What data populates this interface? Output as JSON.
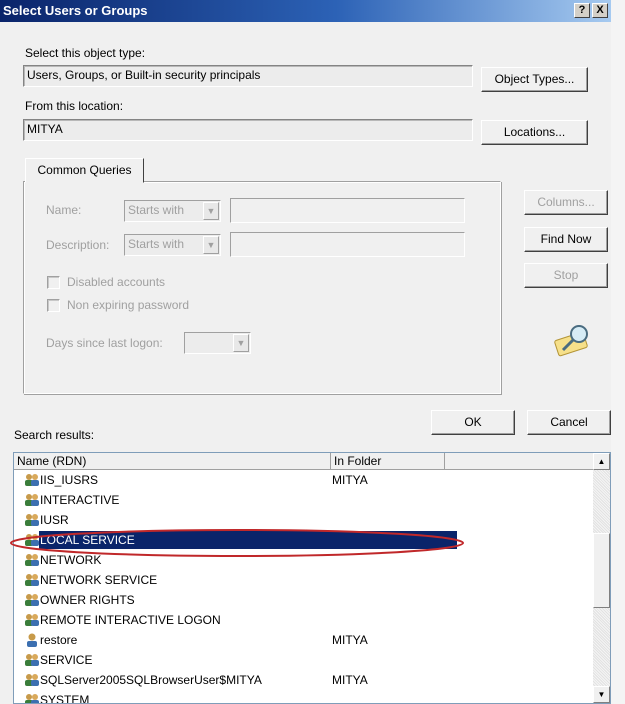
{
  "window": {
    "title": "Select Users or Groups",
    "help_glyph": "?",
    "close_glyph": "X"
  },
  "object_type": {
    "label": "Select this object type:",
    "value": "Users, Groups, or Built-in security principals",
    "button": "Object Types..."
  },
  "location": {
    "label": "From this location:",
    "value": "MITYA",
    "button": "Locations..."
  },
  "common_queries": {
    "tab": "Common Queries",
    "name_label": "Name:",
    "description_label": "Description:",
    "starts_with": "Starts with",
    "disabled_accounts": "Disabled accounts",
    "non_expiring_password": "Non expiring password",
    "days_since_last_logon": "Days since last logon:"
  },
  "side_buttons": {
    "columns": "Columns...",
    "find_now": "Find Now",
    "stop": "Stop"
  },
  "dialog_buttons": {
    "ok": "OK",
    "cancel": "Cancel"
  },
  "results": {
    "label": "Search results:",
    "headers": [
      "Name (RDN)",
      "In Folder"
    ],
    "rows": [
      {
        "name": "IIS_IUSRS",
        "folder": "MITYA",
        "icon": "group-icon"
      },
      {
        "name": "INTERACTIVE",
        "folder": "",
        "icon": "group-icon"
      },
      {
        "name": "IUSR",
        "folder": "",
        "icon": "group-icon"
      },
      {
        "name": "LOCAL SERVICE",
        "folder": "",
        "icon": "group-icon",
        "selected": true
      },
      {
        "name": "NETWORK",
        "folder": "",
        "icon": "group-icon"
      },
      {
        "name": "NETWORK SERVICE",
        "folder": "",
        "icon": "group-icon"
      },
      {
        "name": "OWNER RIGHTS",
        "folder": "",
        "icon": "group-icon"
      },
      {
        "name": "REMOTE INTERACTIVE LOGON",
        "folder": "",
        "icon": "group-icon"
      },
      {
        "name": "restore",
        "folder": "MITYA",
        "icon": "user-icon"
      },
      {
        "name": "SERVICE",
        "folder": "",
        "icon": "group-icon"
      },
      {
        "name": "SQLServer2005SQLBrowserUser$MITYA",
        "folder": "MITYA",
        "icon": "group-icon"
      },
      {
        "name": "SYSTEM",
        "folder": "",
        "icon": "group-icon"
      }
    ]
  },
  "colors": {
    "selection": "#0a246a",
    "highlight_ring": "#c0282a",
    "title_start": "#0a246a",
    "title_end": "#a6caf0"
  }
}
